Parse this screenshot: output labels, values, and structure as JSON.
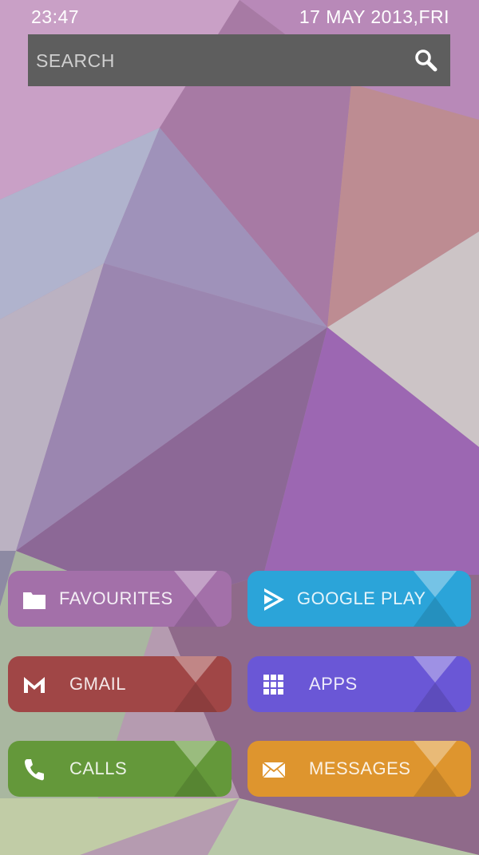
{
  "status_bar": {
    "time": "23:47",
    "date": "17 MAY 2013,FRI"
  },
  "search": {
    "placeholder": "SEARCH",
    "icon": "search-icon"
  },
  "tiles": [
    {
      "label": "FAVOURITES",
      "icon": "folder-icon",
      "color": "#a370a9"
    },
    {
      "label": "GOOGLE PLAY",
      "icon": "play-store-icon",
      "color": "#2ba4d9"
    },
    {
      "label": "GMAIL",
      "icon": "gmail-icon",
      "color": "#a04646"
    },
    {
      "label": "APPS",
      "icon": "apps-grid-icon",
      "color": "#6a57d6"
    },
    {
      "label": "CALLS",
      "icon": "phone-icon",
      "color": "#64983a"
    },
    {
      "label": "MESSAGES",
      "icon": "envelope-icon",
      "color": "#de952e"
    }
  ]
}
